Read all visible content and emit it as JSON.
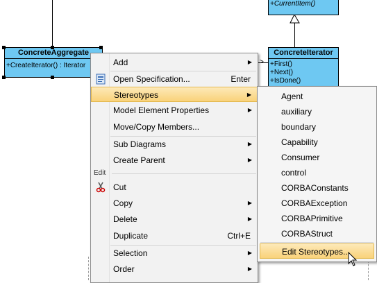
{
  "diagram": {
    "aggregate": {
      "name": "ConcreteAggregate",
      "op": "+CreateIterator() : Iterator"
    },
    "iterator": {
      "name": "ConcreteIterator",
      "ops": [
        "+First()",
        "+Next()",
        "+IsDone()"
      ]
    },
    "top_class": {
      "op": "+CurrentItem()"
    }
  },
  "context_menu": {
    "items": [
      {
        "label": "Add",
        "submenu": true
      },
      {
        "label": "Open Specification...",
        "accel": "Enter",
        "icon": "specification-icon"
      },
      {
        "label": "Stereotypes",
        "submenu": true,
        "active": true
      },
      {
        "label": "Model Element Properties",
        "submenu": true
      },
      {
        "label": "Move/Copy Members..."
      },
      {
        "label": "Sub Diagrams",
        "submenu": true
      },
      {
        "label": "Create Parent",
        "submenu": true
      },
      {
        "label": "Cut",
        "icon": "scissors-icon"
      },
      {
        "label": "Copy",
        "submenu": true
      },
      {
        "label": "Delete",
        "submenu": true
      },
      {
        "label": "Duplicate",
        "accel": "Ctrl+E"
      },
      {
        "label": "Selection",
        "submenu": true
      },
      {
        "label": "Order",
        "submenu": true
      }
    ],
    "edit_section_label": "Edit"
  },
  "stereotypes_submenu": {
    "items": [
      "Agent",
      "auxiliary",
      "boundary",
      "Capability",
      "Consumer",
      "control",
      "CORBAConstants",
      "CORBAException",
      "CORBAPrimitive",
      "CORBAStruct"
    ],
    "edit_label": "Edit Stereotypes..."
  },
  "colors": {
    "class_fill": "#6ec8f2",
    "menu_bg": "#f2f2f2",
    "highlight": "#f9d27a"
  }
}
